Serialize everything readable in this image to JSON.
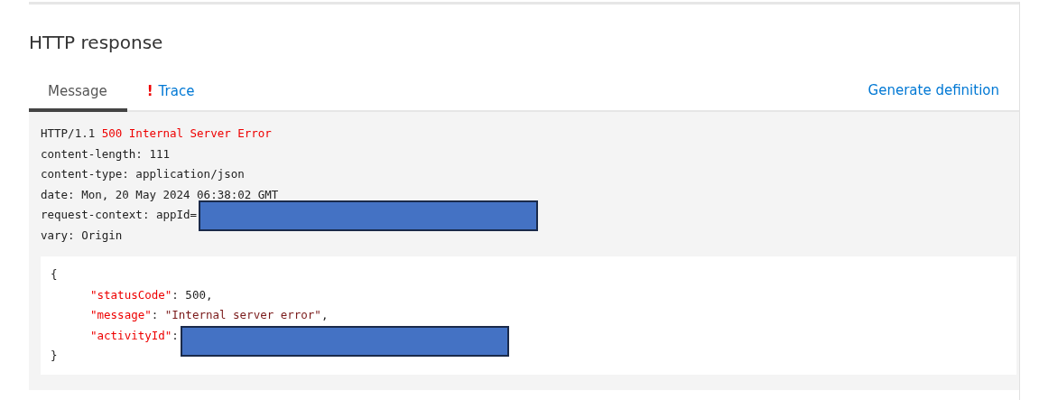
{
  "section": {
    "title": "HTTP response"
  },
  "tabs": [
    {
      "label": "Message",
      "selected": true,
      "warning": false
    },
    {
      "label": "Trace",
      "selected": false,
      "warning": true,
      "warning_mark": "!"
    }
  ],
  "action_link": "Generate definition",
  "headers": [
    {
      "parts": [
        {
          "text": "HTTP/1.1 ",
          "kind": "plain"
        },
        {
          "text": "500 Internal Server Error",
          "kind": "status"
        }
      ]
    },
    {
      "parts": [
        {
          "text": "content-length: 111",
          "kind": "plain"
        }
      ]
    },
    {
      "parts": [
        {
          "text": "content-type: application/json",
          "kind": "plain"
        }
      ]
    },
    {
      "parts": [
        {
          "text": "date: Mon, 20 May 2024 06:38:02 GMT",
          "kind": "plain"
        }
      ]
    },
    {
      "parts": [
        {
          "text": "request-context: appId=",
          "kind": "plain"
        },
        {
          "kind": "redaction"
        }
      ]
    },
    {
      "parts": [
        {
          "text": "vary: Origin",
          "kind": "plain"
        }
      ]
    }
  ],
  "body": [
    {
      "parts": [
        {
          "text": "{",
          "kind": "plain"
        }
      ],
      "children": [
        {
          "parts": [
            {
              "text": "\"statusCode\"",
              "kind": "key"
            },
            {
              "text": ": 500,",
              "kind": "plain"
            }
          ]
        },
        {
          "parts": [
            {
              "text": "\"message\"",
              "kind": "key"
            },
            {
              "text": ": ",
              "kind": "plain"
            },
            {
              "text": "\"Internal server error\"",
              "kind": "string"
            },
            {
              "text": ",",
              "kind": "plain"
            }
          ]
        },
        {
          "parts": [
            {
              "text": "\"activityId\"",
              "kind": "key"
            },
            {
              "text": ":",
              "kind": "plain"
            },
            {
              "kind": "redaction"
            }
          ]
        }
      ]
    },
    {
      "parts": [
        {
          "text": "}",
          "kind": "plain"
        }
      ]
    }
  ]
}
